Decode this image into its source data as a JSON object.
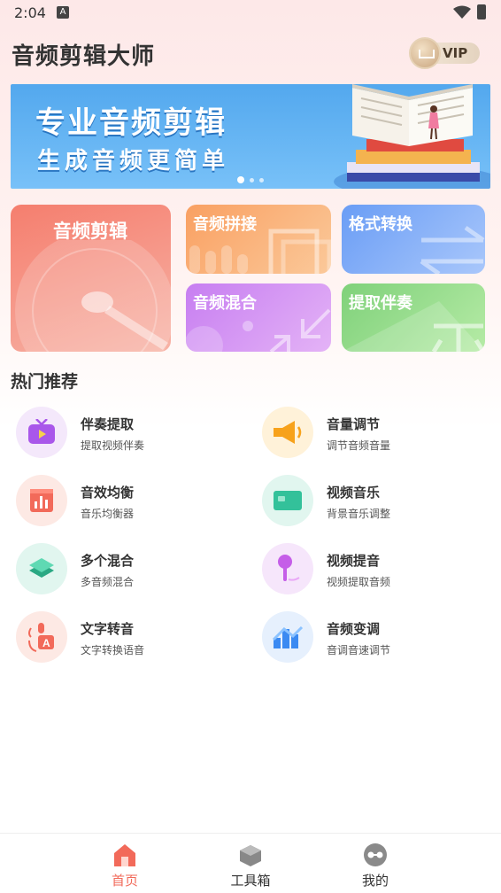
{
  "status_bar": {
    "time": "2:04",
    "notification_icon": "A"
  },
  "header": {
    "title": "音频剪辑大师",
    "vip_label": "VIP"
  },
  "banner": {
    "line1": "专业音频剪辑",
    "line2": "生成音频更简单",
    "slide_count": 3,
    "active_slide": 0
  },
  "tools": {
    "edit": "音频剪辑",
    "splice": "音频拼接",
    "format": "格式转换",
    "mix": "音频混合",
    "accompaniment": "提取伴奏"
  },
  "section": {
    "hot_title": "热门推荐"
  },
  "features": [
    {
      "name": "伴奏提取",
      "desc": "提取视频伴奏",
      "icon": "tv-icon",
      "color": "#a957ea",
      "bg": "#f4e8fb"
    },
    {
      "name": "音量调节",
      "desc": "调节音频音量",
      "icon": "megaphone-icon",
      "color": "#f7a21b",
      "bg": "#fff2d9"
    },
    {
      "name": "音效均衡",
      "desc": "音乐均衡器",
      "icon": "equalizer-icon",
      "color": "#f26a5a",
      "bg": "#fde9e4"
    },
    {
      "name": "视频音乐",
      "desc": "背景音乐调整",
      "icon": "video-icon",
      "color": "#33c19a",
      "bg": "#e1f6ef"
    },
    {
      "name": "多个混合",
      "desc": "多音频混合",
      "icon": "layers-icon",
      "color": "#33c19a",
      "bg": "#e1f6ef"
    },
    {
      "name": "视频提音",
      "desc": "视频提取音频",
      "icon": "microphone-icon",
      "color": "#c55ee8",
      "bg": "#f6e6fb"
    },
    {
      "name": "文字转音",
      "desc": "文字转换语音",
      "icon": "text-speech-icon",
      "color": "#f26a5a",
      "bg": "#fde9e4"
    },
    {
      "name": "音频变调",
      "desc": "音调音速调节",
      "icon": "wave-chart-icon",
      "color": "#3b8af2",
      "bg": "#e6f0fd"
    }
  ],
  "tabs": [
    {
      "label": "首页",
      "icon": "home-icon",
      "active": true
    },
    {
      "label": "工具箱",
      "icon": "toolbox-icon",
      "active": false
    },
    {
      "label": "我的",
      "icon": "profile-icon",
      "active": false
    }
  ],
  "colors": {
    "accent": "#f26a5a",
    "text": "#333333"
  }
}
